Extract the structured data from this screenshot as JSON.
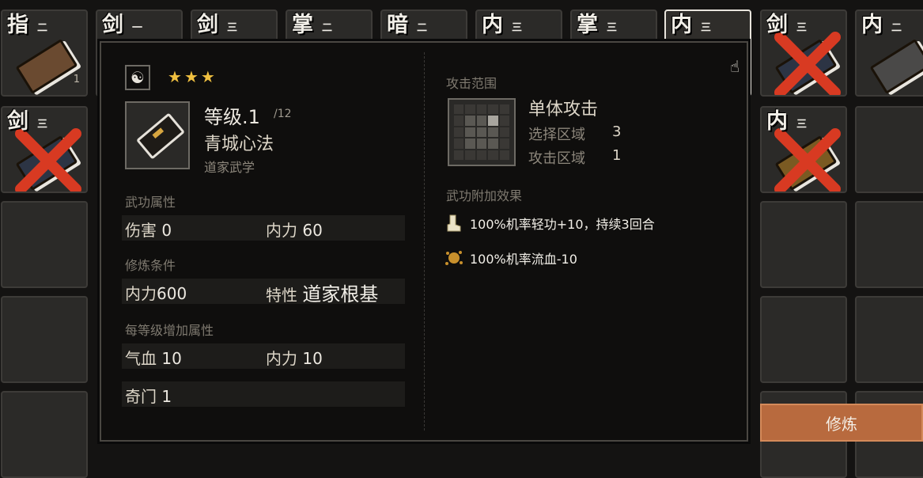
{
  "inventory": {
    "slots": [
      {
        "category": "指",
        "tier": "二",
        "count": "1",
        "book": "brown",
        "crossed": false,
        "selected": false
      },
      {
        "category": "剑",
        "tier": "一",
        "count": "",
        "book": "dark",
        "crossed": false,
        "selected": false
      },
      {
        "category": "剑",
        "tier": "三",
        "count": "",
        "book": "dark",
        "crossed": false,
        "selected": false
      },
      {
        "category": "掌",
        "tier": "二",
        "count": "",
        "book": "dark",
        "crossed": false,
        "selected": false
      },
      {
        "category": "暗",
        "tier": "二",
        "count": "",
        "book": "dark",
        "crossed": false,
        "selected": false
      },
      {
        "category": "内",
        "tier": "三",
        "count": "",
        "book": "dark",
        "crossed": false,
        "selected": false
      },
      {
        "category": "掌",
        "tier": "三",
        "count": "",
        "book": "dark",
        "crossed": false,
        "selected": false
      },
      {
        "category": "内",
        "tier": "三",
        "count": "",
        "book": "dark",
        "crossed": false,
        "selected": true
      },
      {
        "category": "剑",
        "tier": "三",
        "count": "",
        "book": "dark",
        "crossed": true,
        "selected": false
      },
      {
        "category": "内",
        "tier": "二",
        "count": "",
        "book": "gray",
        "crossed": false,
        "selected": false
      },
      {
        "category": "剑",
        "tier": "三",
        "count": "",
        "book": "dark",
        "crossed": true,
        "selected": false
      },
      {
        "category": "内",
        "tier": "三",
        "count": "",
        "book": "gold",
        "crossed": true,
        "selected": false
      }
    ]
  },
  "tooltip": {
    "rarity_stars": 3,
    "star_glyph": "★",
    "yinyang": "☯",
    "level_label": "等级.1",
    "level_max": "/12",
    "skill_name": "青城心法",
    "skill_school": "道家武学",
    "attributes_title": "武功属性",
    "damage_label": "伤害",
    "damage_value": "0",
    "inner_power_label": "内力",
    "inner_power_value": "60",
    "requirements_title": "修炼条件",
    "req_inner_label": "内力",
    "req_inner_value": "600",
    "trait_label": "特性",
    "trait_value": "道家根基",
    "per_level_title": "每等级增加属性",
    "hp_label": "气血",
    "hp_value": "10",
    "per_inner_label": "内力",
    "per_inner_value": "10",
    "qimen_label": "奇门",
    "qimen_value": "1",
    "attack_range_title": "攻击范围",
    "range_type": "单体攻击",
    "select_area_label": "选择区域",
    "select_area_value": "3",
    "attack_area_label": "攻击区域",
    "attack_area_value": "1",
    "bonus_effects_title": "武功附加效果",
    "effects": [
      {
        "icon": "boot-icon",
        "text": "100%机率轻功+10，持续3回合"
      },
      {
        "icon": "blood-splat-icon",
        "text": "100%机率流血-10"
      }
    ]
  },
  "actions": {
    "train_label": "修炼"
  },
  "colors": {
    "accent": "#b86a3e",
    "star": "#f0c040",
    "cross": "#d83a22"
  }
}
